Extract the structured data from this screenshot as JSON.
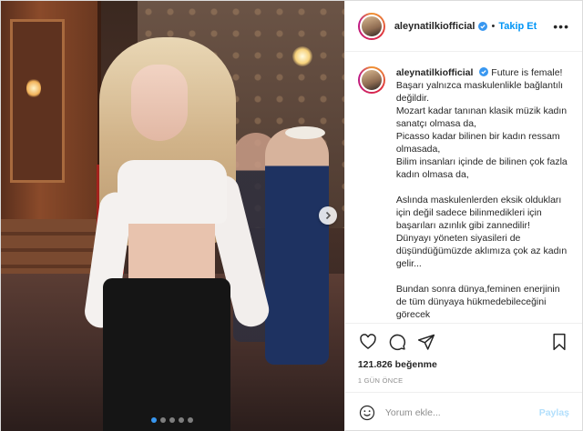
{
  "post": {
    "username": "aleynatilkiofficial",
    "separator": "•",
    "follow_label": "Takip Et",
    "more_label": "•••",
    "caption_lines": [
      "Başarı yalnızca maskulenlikle bağlantılı değildir.",
      "Mozart kadar tanınan klasik müzik kadın sanatçı olmasa da,",
      "Picasso kadar bilinen bir kadın ressam olmasada,",
      "Bilim insanları içinde de bilinen çok fazla kadın olmasa da,",
      "",
      "Aslında maskulenlerden eksik oldukları için değil sadece bilinmedikleri için başarıları azınlık gibi zannedilir!",
      "Dünyayı yöneten siyasileri de düşündüğümüzde aklımıza çok az kadın gelir...",
      "",
      "Bundan sonra dünya,feminen enerjinin de tüm dünyaya hükmedebileceğini görecek"
    ],
    "caption_first": "Future is female!",
    "likes": "121.826 beğenme",
    "time_ago": "1 GÜN ÖNCE",
    "comment_placeholder": "Yorum ekle...",
    "post_button": "Paylaş"
  },
  "carousel": {
    "slides": 5,
    "active_index": 0
  },
  "colors": {
    "follow": "#0095f6",
    "verified": "#3897f0",
    "muted": "#8e8e8e",
    "post_disabled": "#b2dffc"
  },
  "icons": [
    "verified-badge-icon",
    "more-options-icon",
    "carousel-next-icon",
    "heart-icon",
    "comment-icon",
    "share-icon",
    "bookmark-icon",
    "emoji-icon"
  ]
}
